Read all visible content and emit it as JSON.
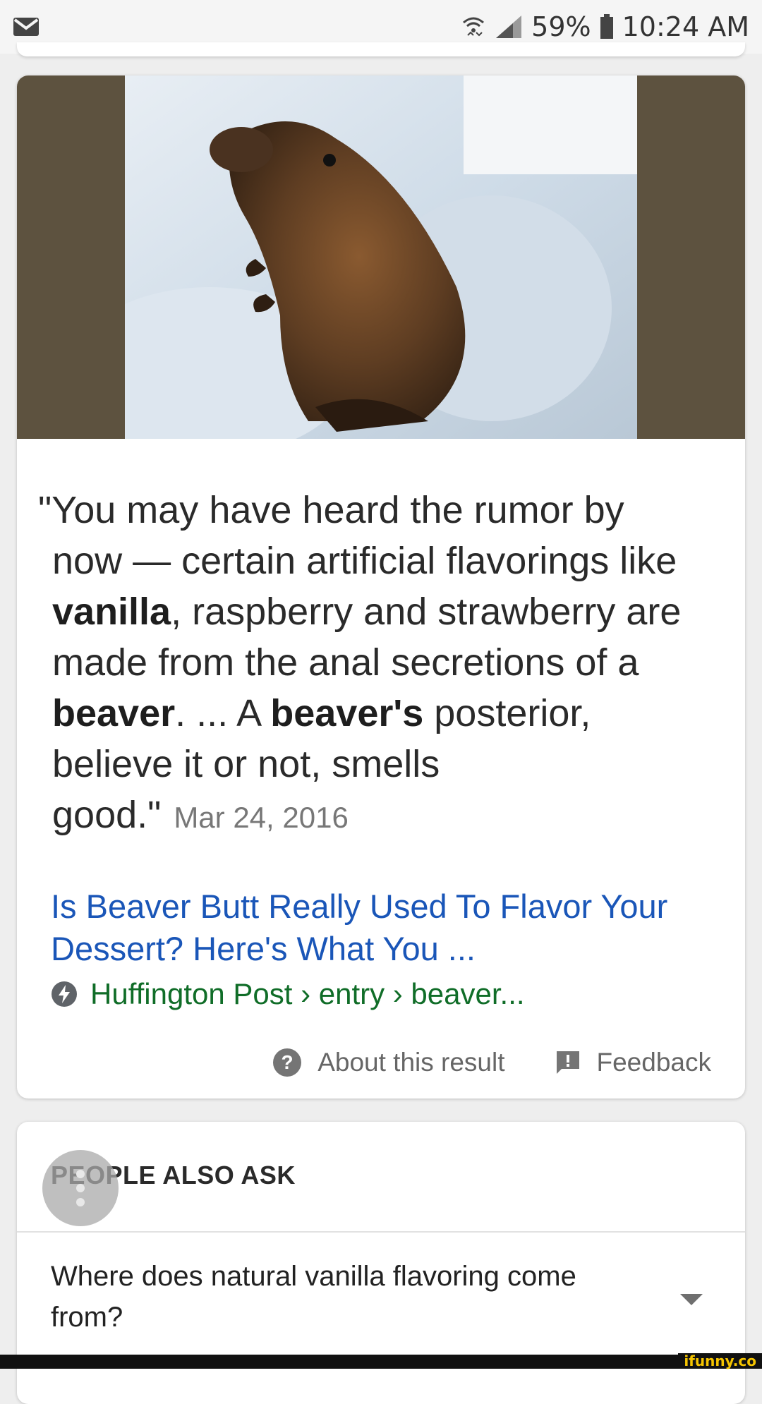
{
  "status_bar": {
    "battery": "59%",
    "time": "10:24 AM",
    "icons": [
      "mail-icon",
      "wifi-icon",
      "signal-icon",
      "battery-icon"
    ]
  },
  "result_card": {
    "image_subject": "beaver-photo",
    "snippet": {
      "line1": "\"You may have heard the rumor by",
      "line2": "now — certain artificial flavorings like",
      "line3_bold": "vanilla",
      "line3_rest": ", raspberry and strawberry are",
      "line4": "made from the anal secretions of a",
      "line5_bold1": "beaver",
      "line5_mid": ". ... A ",
      "line5_bold2": "beaver's",
      "line5_rest": " posterior,",
      "line6": "believe it or not, smells",
      "line7": "good.\"",
      "date": "Mar 24, 2016"
    },
    "link_title": "Is Beaver Butt Really Used To Flavor Your Dessert? Here's What You ...",
    "source": "Huffington Post › entry › beaver...",
    "about_label": "About this result",
    "feedback_label": "Feedback"
  },
  "people_also_ask": {
    "title": "PEOPLE ALSO ASK",
    "question": "Where does natural vanilla flavoring come from?"
  },
  "watermark": "ifunny.co",
  "colors": {
    "link": "#1a56b8",
    "source": "#106d28",
    "image_bg": "#5d523f"
  }
}
